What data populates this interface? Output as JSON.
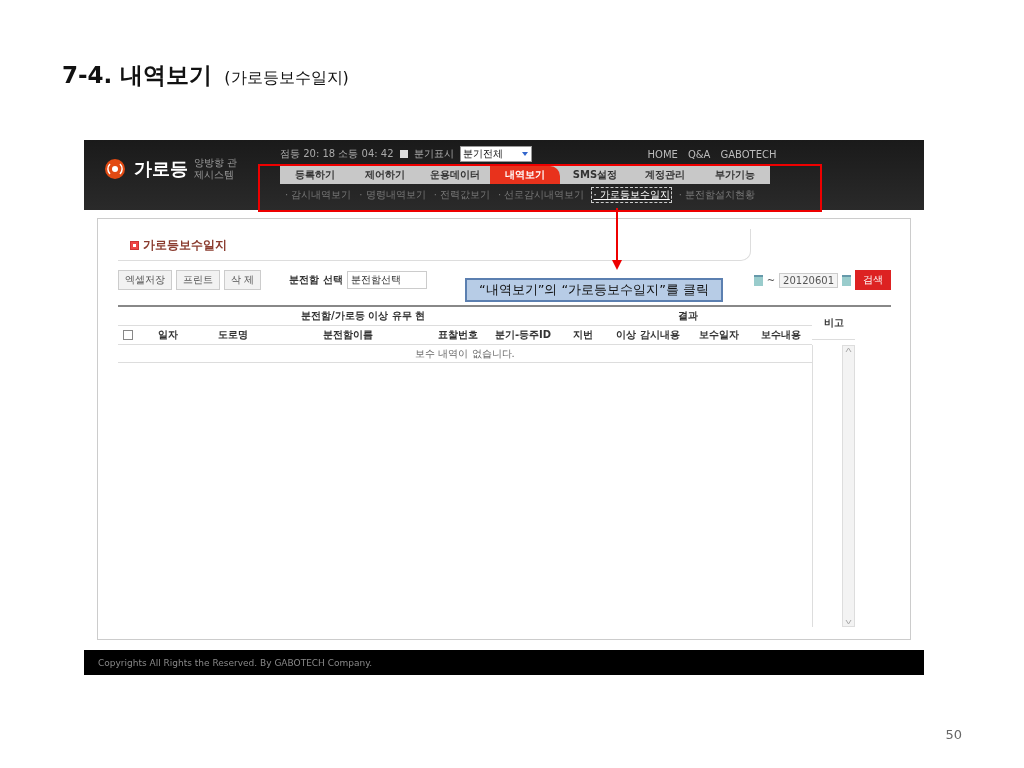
{
  "slide": {
    "title": "7-4. 내역보기",
    "subtitle": "(가로등보수일지)",
    "page_number": "50"
  },
  "app": {
    "logo_text": "가로등",
    "logo_subtitle": "양방향 관제시스템",
    "status": "점등 20: 18 소등 04: 42",
    "branch_toggle": {
      "label": "분기표시",
      "checked": false
    },
    "branch_select": "분기전체",
    "links": [
      "HOME",
      "Q&A",
      "GABOTECH"
    ],
    "nav": [
      {
        "label": "등록하기",
        "selected": false
      },
      {
        "label": "제어하기",
        "selected": false
      },
      {
        "label": "운용데이터",
        "selected": false
      },
      {
        "label": "내역보기",
        "selected": true
      },
      {
        "label": "SMS설정",
        "selected": false
      },
      {
        "label": "계정관리",
        "selected": false
      },
      {
        "label": "부가기능",
        "selected": false
      }
    ],
    "subnav": [
      {
        "label": "· 감시내역보기",
        "selected": false
      },
      {
        "label": "· 명령내역보기",
        "selected": false
      },
      {
        "label": "· 전력값보기",
        "selected": false
      },
      {
        "label": "· 선로감시내역보기",
        "selected": false
      },
      {
        "label": "· 가로등보수일지",
        "selected": true
      },
      {
        "label": "· 분전함설치현황",
        "selected": false
      }
    ],
    "page_title": "가로등보수일지",
    "toolbar": [
      "엑셀저장",
      "프린트",
      "삭 제"
    ],
    "filter": {
      "label": "분전함 선택",
      "value": "분전함선택",
      "end_date": "20120601",
      "date_sep": "~",
      "search": "검색"
    },
    "table": {
      "group_header": "분전함/가로등 이상 유무 현",
      "group_header_end": "결과",
      "note_column": "비고",
      "select_all": {
        "checked": false
      },
      "columns": [
        "일자",
        "도로명",
        "분전함이름",
        "표찰번호",
        "분기-등주ID",
        "지번",
        "이상 감시내용",
        "보수일자",
        "보수내용"
      ],
      "empty_message": "보수 내역이 없습니다."
    },
    "footer": "Copyrights All Rights the Reserved. By GABOTECH Company."
  },
  "callout": "“내역보기”의 “가로등보수일지”를 클릭"
}
